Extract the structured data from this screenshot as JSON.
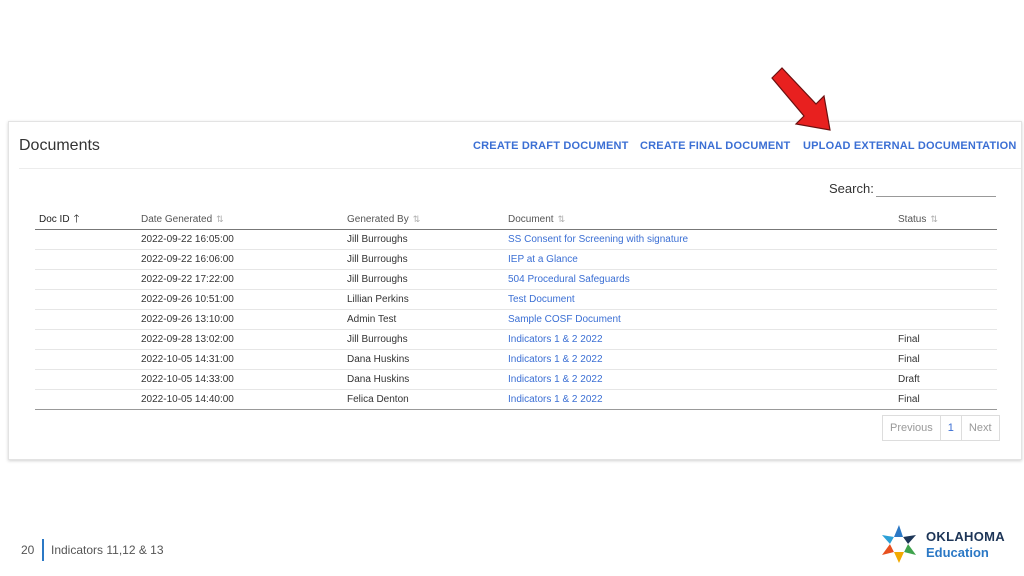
{
  "panel": {
    "title": "Documents",
    "actions": {
      "create_draft": "CREATE DRAFT DOCUMENT",
      "create_final": "CREATE FINAL DOCUMENT",
      "upload_external": "UPLOAD EXTERNAL DOCUMENTATION"
    },
    "search": {
      "label": "Search:",
      "value": ""
    }
  },
  "table": {
    "headers": {
      "doc_id": "Doc ID",
      "date_generated": "Date Generated",
      "generated_by": "Generated By",
      "document": "Document",
      "status": "Status"
    },
    "sort_glyphs": {
      "active_asc": "🡑",
      "inactive": "⇅"
    },
    "rows": [
      {
        "doc_id": "",
        "date": "2022-09-22 16:05:00",
        "by": "Jill Burroughs",
        "document": "SS Consent for Screening with signature",
        "status": ""
      },
      {
        "doc_id": "",
        "date": "2022-09-22 16:06:00",
        "by": "Jill Burroughs",
        "document": "IEP at a Glance",
        "status": ""
      },
      {
        "doc_id": "",
        "date": "2022-09-22 17:22:00",
        "by": "Jill Burroughs",
        "document": "504 Procedural Safeguards",
        "status": ""
      },
      {
        "doc_id": "",
        "date": "2022-09-26 10:51:00",
        "by": "Lillian Perkins",
        "document": "Test Document",
        "status": ""
      },
      {
        "doc_id": "",
        "date": "2022-09-26 13:10:00",
        "by": "Admin Test",
        "document": "Sample COSF Document",
        "status": ""
      },
      {
        "doc_id": "",
        "date": "2022-09-28 13:02:00",
        "by": "Jill Burroughs",
        "document": "Indicators 1 & 2 2022",
        "status": "Final"
      },
      {
        "doc_id": "",
        "date": "2022-10-05 14:31:00",
        "by": "Dana Huskins",
        "document": "Indicators 1 & 2 2022",
        "status": "Final"
      },
      {
        "doc_id": "",
        "date": "2022-10-05 14:33:00",
        "by": "Dana Huskins",
        "document": "Indicators 1 & 2 2022",
        "status": "Draft"
      },
      {
        "doc_id": "",
        "date": "2022-10-05 14:40:00",
        "by": "Felica Denton",
        "document": "Indicators 1 & 2 2022",
        "status": "Final"
      }
    ]
  },
  "pagination": {
    "previous": "Previous",
    "current": "1",
    "next": "Next"
  },
  "footer": {
    "slide_number": "20",
    "caption": "Indicators 11,12 & 13",
    "logo_line1": "OKLAHOMA",
    "logo_line2": "Education"
  },
  "colors": {
    "link": "#3b6fd4",
    "arrow": "#e8201f",
    "brand_navy": "#1d3557",
    "brand_blue": "#2b78c5"
  },
  "icons": {
    "callout": "red-arrow-icon",
    "logo": "oklahoma-star-logo-icon"
  }
}
